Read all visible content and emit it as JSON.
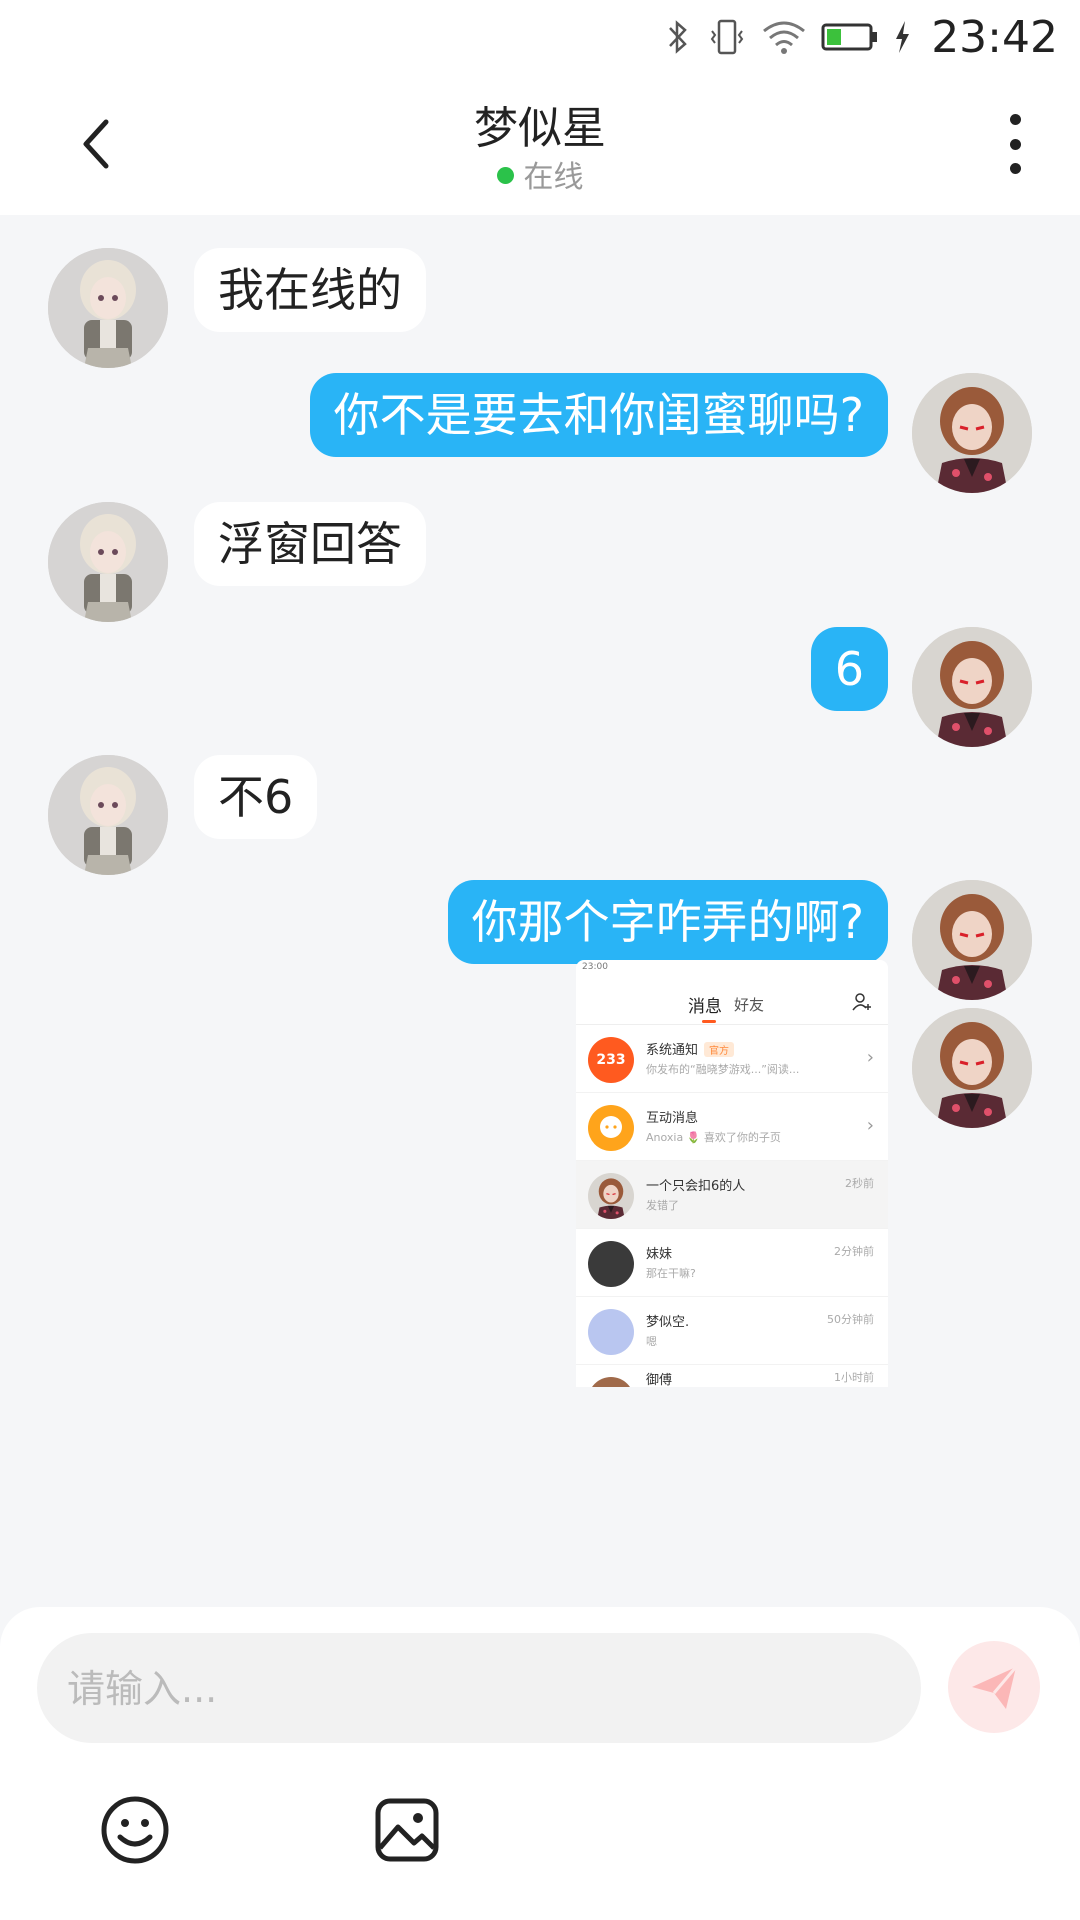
{
  "status_bar": {
    "time": "23:42",
    "battery_color": "#3cc13c"
  },
  "header": {
    "title": "梦似星",
    "status": "在线",
    "back_icon": "chevron-left-icon",
    "more_icon": "more-vertical-icon"
  },
  "messages": [
    {
      "side": "left",
      "text": "我在线的"
    },
    {
      "side": "right",
      "text": "你不是要去和你闺蜜聊吗?"
    },
    {
      "side": "left",
      "text": "浮窗回答"
    },
    {
      "side": "right",
      "text": "6"
    },
    {
      "side": "left",
      "text": "不6"
    },
    {
      "side": "right",
      "text": "你那个字咋弄的啊?"
    }
  ],
  "screenshot": {
    "status_time": "23:00",
    "tab_messages": "消息",
    "tab_friends": "好友",
    "rows": [
      {
        "name": "系统通知",
        "tag": "官方",
        "sub": "你发布的“融晓梦游戏...”阅读...",
        "time": ""
      },
      {
        "name": "互动消息",
        "sub": "Anoxia 🌷 喜欢了你的子页",
        "time": ""
      },
      {
        "name": "一个只会扣6的人",
        "sub": "发错了",
        "time": "2秒前"
      },
      {
        "name": "妹妹",
        "sub": "那在干嘛?",
        "time": "2分钟前"
      },
      {
        "name": "梦似空.",
        "sub": "嗯",
        "time": "50分钟前"
      },
      {
        "name": "御傅",
        "sub": "",
        "time": "1小时前"
      }
    ],
    "badge_233": "233"
  },
  "input": {
    "placeholder": "请输入..."
  },
  "colors": {
    "accent": "#29b4f6",
    "online": "#2bc24a",
    "send_bg": "#fde8e8"
  }
}
